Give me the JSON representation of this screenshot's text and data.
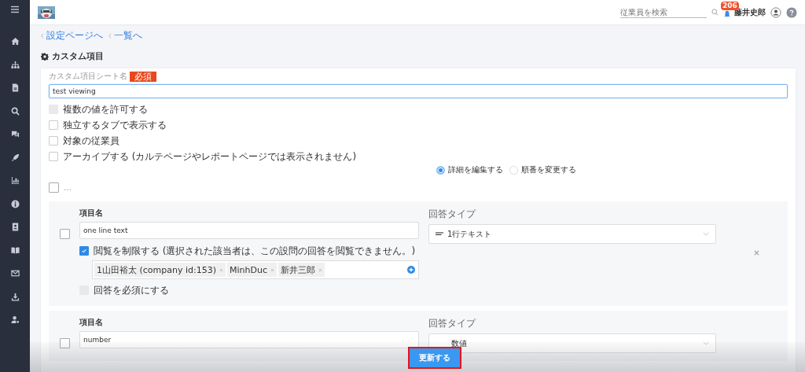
{
  "header": {
    "search_placeholder": "従業員を検索",
    "notification_count": "206",
    "user_name": "藤井史郎"
  },
  "breadcrumbs": [
    "設定ページへ",
    "一覧へ"
  ],
  "page_title": "カスタム項目",
  "sheet": {
    "label": "カスタム項目シート名",
    "required_badge": "必須",
    "value": "test viewing"
  },
  "options": [
    {
      "label": "複数の値を許可する",
      "checked": false,
      "disabled": true
    },
    {
      "label": "独立するタブで表示する",
      "checked": false,
      "disabled": false
    },
    {
      "label": "対象の従業員",
      "checked": false,
      "disabled": false
    },
    {
      "label": "アーカイブする (カルテページやレポートページでは表示されません)",
      "checked": false,
      "disabled": false
    }
  ],
  "mode_radios": [
    {
      "label": "詳細を編集する",
      "selected": true
    },
    {
      "label": "順番を変更する",
      "selected": false
    }
  ],
  "select_all": {
    "label": "…",
    "checked": false
  },
  "questions": [
    {
      "checked": false,
      "name_label": "項目名",
      "name_value": "one line text",
      "type_label": "回答タイプ",
      "type_value": "1行テキスト",
      "restrict": {
        "label": "閲覧を制限する (選択された該当者は、この設問の回答を閲覧できません。)",
        "checked": true,
        "tags": [
          "1山田裕太 (company id:153)",
          "MinhDuc",
          "新井三郎"
        ]
      },
      "required": {
        "label": "回答を必須にする",
        "checked": false,
        "disabled": true
      }
    },
    {
      "checked": false,
      "name_label": "項目名",
      "name_value": "number",
      "type_label": "回答タイプ",
      "type_value": "数値"
    }
  ],
  "save_button": "更新する"
}
